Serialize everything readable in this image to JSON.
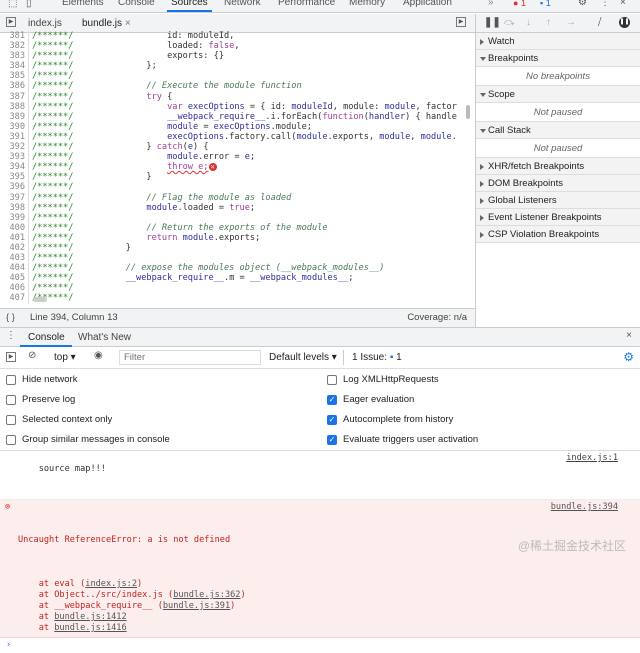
{
  "top_tabs": [
    "Elements",
    "Console",
    "Sources",
    "Network",
    "Performance",
    "Memory",
    "Application"
  ],
  "active_tab": "Sources",
  "more": "»",
  "error_count": "1",
  "issue_count": "1",
  "file_tabs": [
    "index.js",
    "bundle.js"
  ],
  "close": "×",
  "code_lines": [
    {
      "n": "381",
      "html": "            id: moduleId,"
    },
    {
      "n": "382",
      "html": "            loaded: <span class='lit'>false</span>,"
    },
    {
      "n": "383",
      "html": "            exports: {}"
    },
    {
      "n": "384",
      "html": "        };"
    },
    {
      "n": "385",
      "html": ""
    },
    {
      "n": "386",
      "html": "        <span class='cm'>// Execute the module function</span>"
    },
    {
      "n": "387",
      "html": "        <span class='kw'>try</span> {"
    },
    {
      "n": "388",
      "html": "            <span class='kw'>var</span> <span class='v'>execOptions</span> = { id: <span class='v'>moduleId</span>, module: <span class='v'>module</span>, factor"
    },
    {
      "n": "389",
      "html": "            <span class='v'>__webpack_require__</span>.i.forEach(<span class='kw'>function</span>(<span class='v'>handler</span>) { handle"
    },
    {
      "n": "390",
      "html": "            <span class='v'>module</span> = <span class='v'>execOptions</span>.module;"
    },
    {
      "n": "391",
      "html": "            <span class='v'>execOptions</span>.factory.call(<span class='v'>module</span>.exports, <span class='v'>module</span>, <span class='v'>module</span>."
    },
    {
      "n": "392",
      "html": "        } <span class='kw'>catch</span>(<span class='v'>e</span>) {"
    },
    {
      "n": "393",
      "html": "            <span class='v'>module</span>.error = <span class='v'>e</span>;"
    },
    {
      "n": "394",
      "html": "            <span class='kw' style='text-decoration:underline wavy #d33'>throw e;</span><span style='color:#fff;background:#d33;border-radius:50%;font-size:7px;padding:0 2px'>×</span>"
    },
    {
      "n": "395",
      "html": "        }"
    },
    {
      "n": "396",
      "html": ""
    },
    {
      "n": "397",
      "html": "        <span class='cm'>// Flag the module as loaded</span>"
    },
    {
      "n": "398",
      "html": "        <span class='v'>module</span>.loaded = <span class='lit'>true</span>;"
    },
    {
      "n": "399",
      "html": ""
    },
    {
      "n": "400",
      "html": "        <span class='cm'>// Return the exports of the module</span>"
    },
    {
      "n": "401",
      "html": "        <span class='kw'>return</span> <span class='v'>module</span>.exports;"
    },
    {
      "n": "402",
      "html": "    }"
    },
    {
      "n": "403",
      "html": ""
    },
    {
      "n": "404",
      "html": "    <span class='cm'>// expose the modules object (__webpack_modules__)</span>"
    },
    {
      "n": "405",
      "html": "    <span class='v'>__webpack_require__</span>.m = <span class='v'>__webpack_modules__</span>;"
    },
    {
      "n": "406",
      "html": ""
    },
    {
      "n": "407",
      "html": ""
    }
  ],
  "stars": "/******/",
  "status": {
    "position": "Line 394, Column 13",
    "coverage": "Coverage: n/a"
  },
  "sidebar": [
    {
      "label": "Watch",
      "open": false
    },
    {
      "label": "Breakpoints",
      "open": true,
      "empty": "No breakpoints"
    },
    {
      "label": "Scope",
      "open": true,
      "empty": "Not paused"
    },
    {
      "label": "Call Stack",
      "open": true,
      "empty": "Not paused"
    },
    {
      "label": "XHR/fetch Breakpoints",
      "open": false
    },
    {
      "label": "DOM Breakpoints",
      "open": false
    },
    {
      "label": "Global Listeners",
      "open": false
    },
    {
      "label": "Event Listener Breakpoints",
      "open": false
    },
    {
      "label": "CSP Violation Breakpoints",
      "open": false
    }
  ],
  "drawer_tabs": [
    "Console",
    "What's New"
  ],
  "console_toolbar": {
    "context": "top",
    "filter_placeholder": "Filter",
    "levels": "Default levels",
    "issues": "1 Issue:",
    "issue_count": "1"
  },
  "settings": [
    {
      "label": "Hide network",
      "checked": false
    },
    {
      "label": "Log XMLHttpRequests",
      "checked": false
    },
    {
      "label": "Preserve log",
      "checked": false
    },
    {
      "label": "Eager evaluation",
      "checked": true
    },
    {
      "label": "Selected context only",
      "checked": false
    },
    {
      "label": "Autocomplete from history",
      "checked": true
    },
    {
      "label": "Group similar messages in console",
      "checked": false
    },
    {
      "label": "Evaluate triggers user activation",
      "checked": true
    }
  ],
  "messages": {
    "log": {
      "text": "source map!!!",
      "source": "index.js:1"
    },
    "error": {
      "text": "Uncaught ReferenceError: a is not defined",
      "source": "bundle.js:394",
      "stack": [
        {
          "pre": "    at eval (",
          "link": "index.js:2",
          "post": ")"
        },
        {
          "pre": "    at Object../src/index.js (",
          "link": "bundle.js:362",
          "post": ")"
        },
        {
          "pre": "    at __webpack_require__ (",
          "link": "bundle.js:391",
          "post": ")"
        },
        {
          "pre": "    at ",
          "link": "bundle.js:1412",
          "post": ""
        },
        {
          "pre": "    at ",
          "link": "bundle.js:1416",
          "post": ""
        }
      ]
    }
  },
  "watermark": "@稀土掘金技术社区"
}
